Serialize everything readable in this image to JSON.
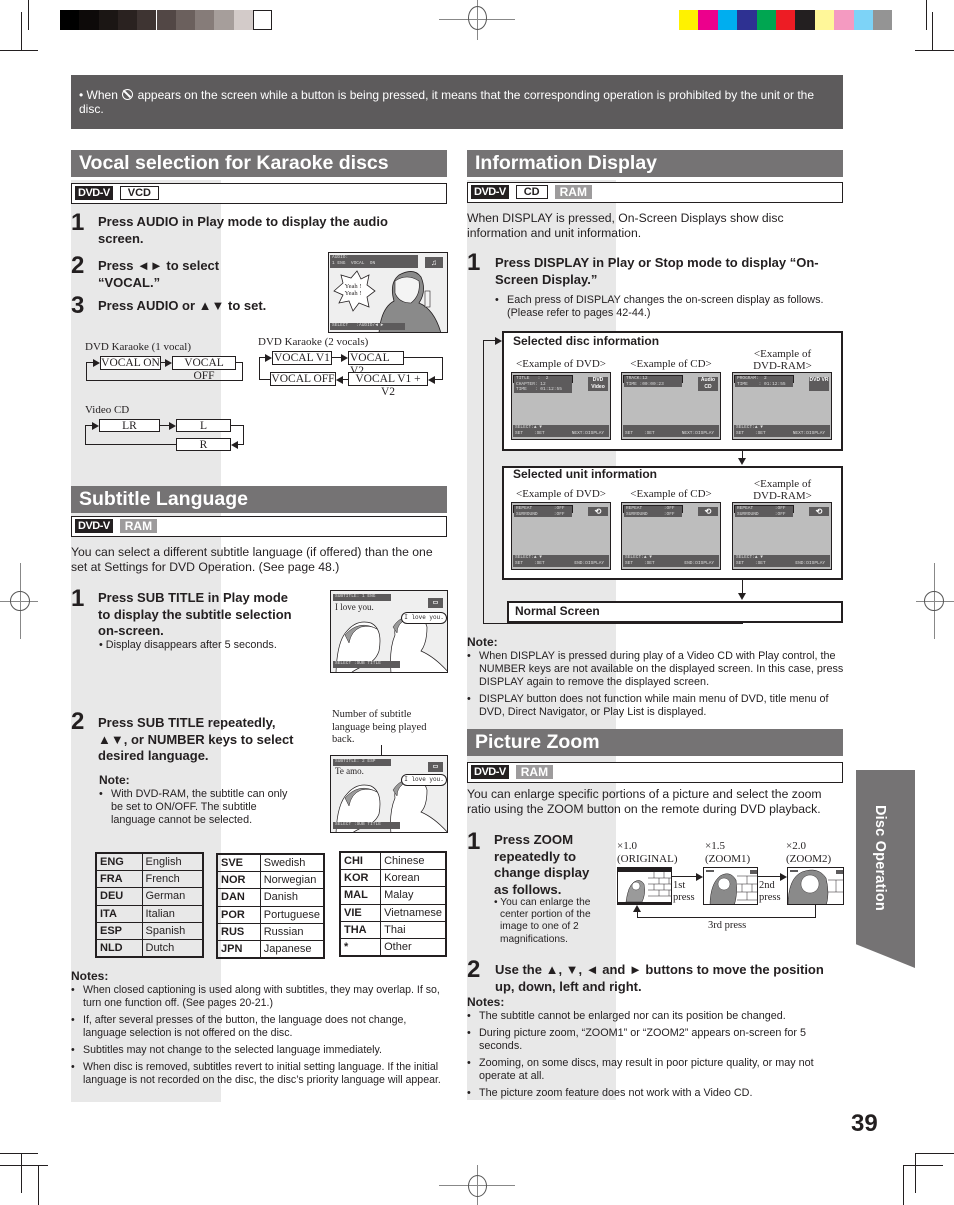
{
  "print_marks": {
    "grayscale_swatches": [
      "#000000",
      "#0d0a09",
      "#1b1614",
      "#2a2220",
      "#3e3432",
      "#524745",
      "#6b605d",
      "#867c79",
      "#a69e9b",
      "#d3cbc9",
      "#ffffff"
    ],
    "color_swatches": [
      "#fff200",
      "#ec008c",
      "#00aeef",
      "#2e3192",
      "#00a651",
      "#ed1c24",
      "#231f20",
      "#fff799",
      "#f49ac1",
      "#7dd3f7",
      "#949494"
    ]
  },
  "notice": {
    "prefix": "• When",
    "icon": "prohibited-icon",
    "text": "appears on the screen while a button is being pressed, it means that the corresponding operation is prohibited by the unit or the disc."
  },
  "karaoke": {
    "title": "Vocal selection for Karaoke discs",
    "discs": [
      "DVD-V",
      "VCD"
    ],
    "steps": [
      {
        "num": "1",
        "text": "Press AUDIO in Play mode to display the audio screen."
      },
      {
        "num": "2",
        "text": "Press ◄► to select “VOCAL.”"
      },
      {
        "num": "3",
        "text": "Press AUDIO or ▲▼ to set."
      }
    ],
    "screen": {
      "osd_top": "AUDIO:",
      "osd_sel": "1 ENG  VOCAL  ON",
      "osd_bottom": "SELECT   :AUDIO/◄ ►",
      "bubble": "Yeah ! Yeah !",
      "icon": "music-note-icon"
    },
    "flow_1vocal": {
      "label": "DVD Karaoke (1 vocal)",
      "items": [
        "VOCAL ON",
        "VOCAL OFF"
      ]
    },
    "flow_2vocals": {
      "label": "DVD Karaoke (2 vocals)",
      "items": [
        "VOCAL V1",
        "VOCAL V2",
        "VOCAL V1 + V2",
        "VOCAL OFF"
      ]
    },
    "flow_vcd": {
      "label": "Video CD",
      "items": [
        "LR",
        "L",
        "R"
      ]
    }
  },
  "subtitle": {
    "title": "Subtitle Language",
    "discs": [
      "DVD-V",
      "RAM"
    ],
    "intro": "You can select a different subtitle language (if offered) than the one set at Settings for DVD Operation. (See page 48.)",
    "step1": {
      "num": "1",
      "text": "Press SUB TITLE in Play mode to display the subtitle selection on-screen.",
      "sub": "• Display disappears after 5 seconds."
    },
    "screen1": {
      "osd_top": "SUBTITLE: 1 ENG",
      "caption": "I love you.",
      "bubble": "I love you.",
      "osd_bottom": "SELECT :SUB TITLE"
    },
    "step2": {
      "num": "2",
      "text": "Press SUB TITLE repeatedly, ▲▼, or NUMBER keys to select desired language."
    },
    "callout": "Number of subtitle language being played back.",
    "screen2": {
      "osd_top": "SUBTITLE: 2 ESP",
      "caption": "Te amo.",
      "bubble": "I love you.",
      "osd_bottom": "SELECT :SUB TITLE"
    },
    "note_title": "Note:",
    "note": "With DVD-RAM, the subtitle can only be set to ON/OFF. The subtitle language cannot be selected.",
    "languages": [
      [
        [
          "ENG",
          "English"
        ],
        [
          "FRA",
          "French"
        ],
        [
          "DEU",
          "German"
        ],
        [
          "ITA",
          "Italian"
        ],
        [
          "ESP",
          "Spanish"
        ],
        [
          "NLD",
          "Dutch"
        ]
      ],
      [
        [
          "SVE",
          "Swedish"
        ],
        [
          "NOR",
          "Norwegian"
        ],
        [
          "DAN",
          "Danish"
        ],
        [
          "POR",
          "Portuguese"
        ],
        [
          "RUS",
          "Russian"
        ],
        [
          "JPN",
          "Japanese"
        ]
      ],
      [
        [
          "CHI",
          "Chinese"
        ],
        [
          "KOR",
          "Korean"
        ],
        [
          "MAL",
          "Malay"
        ],
        [
          "VIE",
          "Vietnamese"
        ],
        [
          "THA",
          "Thai"
        ],
        [
          "*",
          "Other"
        ]
      ]
    ],
    "notes_title": "Notes:",
    "notes": [
      "When closed captioning is used along with subtitles, they may overlap. If so, turn one function off. (See pages 20-21.)",
      "If, after several presses of the button, the language does not change, language selection is not offered on the disc.",
      "Subtitles may not change to the selected language immediately.",
      "When disc is removed, subtitles revert to initial setting language. If the initial language is not recorded on the disc, the disc’s priority language will appear."
    ]
  },
  "info_display": {
    "title": "Information Display",
    "discs": [
      "DVD-V",
      "CD",
      "RAM"
    ],
    "intro": "When DISPLAY is pressed, On-Screen Displays show disc information and unit information.",
    "step1": {
      "num": "1",
      "text": "Press DISPLAY in Play or Stop mode to display “On-Screen Display.”",
      "sub": "Each press of DISPLAY changes the on-screen display as follows. (Please refer to pages 42-44.)"
    },
    "disc_info": {
      "title": "Selected disc information",
      "examples": [
        {
          "label": "<Example of DVD>",
          "lines": [
            "TITLE   :  2",
            "CHAPTER: 12",
            "TIME   : 01:12:55"
          ],
          "bottom": [
            "SELECT:▲ ▼",
            "SET    :SET          NEXT:DISPLAY"
          ],
          "logo": "DVD Video"
        },
        {
          "label": "<Example of CD>",
          "lines": [
            "TRACK:12",
            "TIME :00:00:23"
          ],
          "bottom": [
            "",
            "SET    :SET          NEXT:DISPLAY"
          ],
          "logo": "Audio CD"
        },
        {
          "label": "<Example of DVD-RAM>",
          "lines": [
            "PROGRAM:  2",
            "TIME    : 01:12:55"
          ],
          "bottom": [
            "SELECT:▲ ▼",
            "SET    :SET          NEXT:DISPLAY"
          ],
          "logo": "DVD VR"
        }
      ]
    },
    "unit_info": {
      "title": "Selected unit information",
      "examples": [
        {
          "label": "<Example of DVD>",
          "lines": [
            "REPEAT        :OFF",
            "SURROUND      :OFF"
          ],
          "bottom": [
            "SELECT:▲ ▼",
            "SET    :SET           END:DISPLAY"
          ]
        },
        {
          "label": "<Example of CD>",
          "lines": [
            "REPEAT        :OFF",
            "SURROUND      :OFF"
          ],
          "bottom": [
            "SELECT:▲ ▼",
            "SET    :SET           END:DISPLAY"
          ]
        },
        {
          "label": "<Example of DVD-RAM>",
          "lines": [
            "REPEAT        :OFF",
            "SURROUND      :OFF"
          ],
          "bottom": [
            "SELECT:▲ ▼",
            "SET    :SET           END:DISPLAY"
          ]
        }
      ]
    },
    "normal_screen": "Normal Screen",
    "note_title": "Note:",
    "notes": [
      "When DISPLAY is pressed during play of a Video CD with Play control, the NUMBER keys are not available on the displayed screen. In this case, press DISPLAY again to remove the displayed screen.",
      "DISPLAY button does not function while main menu of DVD, title menu of DVD, Direct Navigator, or Play List is displayed."
    ]
  },
  "picture_zoom": {
    "title": "Picture Zoom",
    "discs": [
      "DVD-V",
      "RAM"
    ],
    "intro": "You can enlarge specific portions of a picture and select the zoom ratio using the ZOOM button on the remote during DVD playback.",
    "step1": {
      "num": "1",
      "text": "Press ZOOM repeatedly to change display as follows.",
      "sub": "• You can enlarge the center portion of the image to one of 2 magnifications."
    },
    "zoom_levels": [
      {
        "ratio": "×1.0",
        "name": "(ORIGINAL)"
      },
      {
        "ratio": "×1.5",
        "name": "(ZOOM1)"
      },
      {
        "ratio": "×2.0",
        "name": "(ZOOM2)"
      }
    ],
    "press_labels": [
      "1st press",
      "2nd press",
      "3rd press"
    ],
    "step2": {
      "num": "2",
      "text": "Use the ▲, ▼, ◄ and ► buttons to move the position up, down, left and right."
    },
    "notes_title": "Notes:",
    "notes": [
      "The subtitle cannot be enlarged nor can its position be changed.",
      "During picture zoom, “ZOOM1” or “ZOOM2” appears on-screen for 5 seconds.",
      "Zooming, on some discs, may result in poor picture quality, or may not operate at all.",
      "The picture zoom feature does not work with a Video CD."
    ]
  },
  "side_tab": "Disc Operation",
  "page_number": "39"
}
